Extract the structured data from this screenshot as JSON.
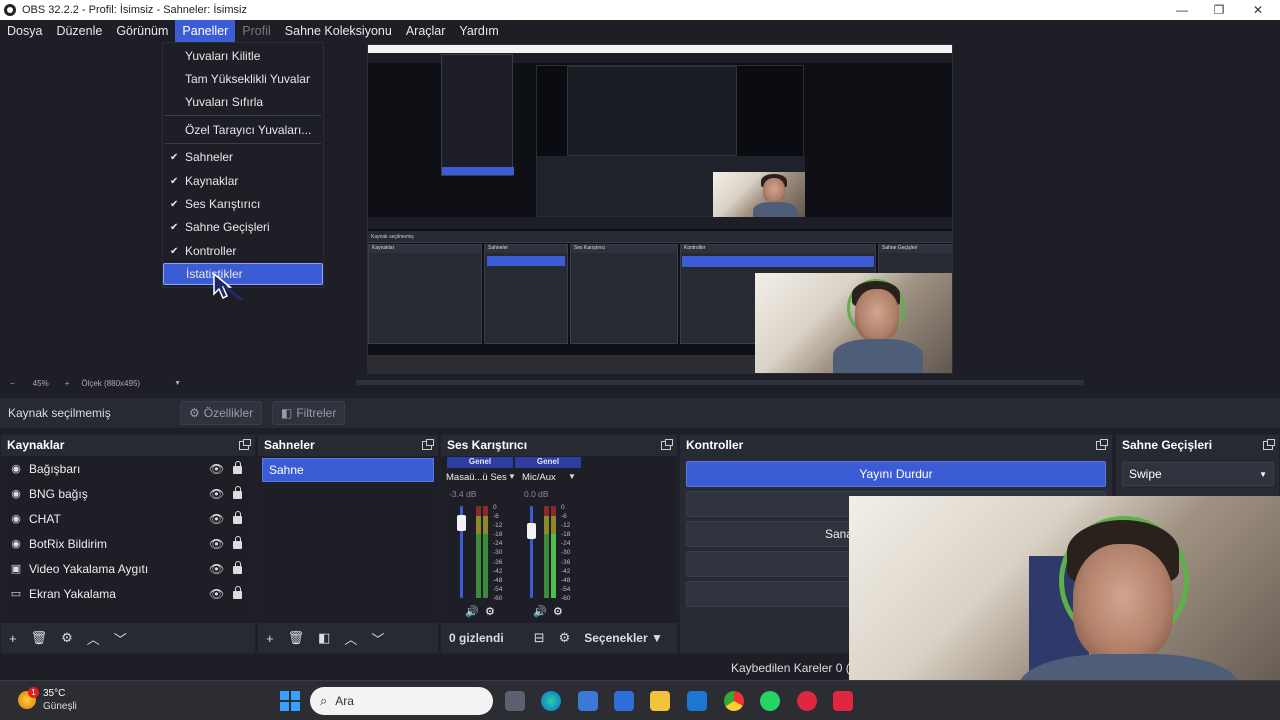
{
  "window": {
    "title": "OBS 32.2.2 - Profil: İsimsiz - Sahneler: İsimsiz",
    "minimize": "—",
    "maximize": "❐",
    "close": "✕"
  },
  "menu": [
    {
      "label": "Dosya"
    },
    {
      "label": "Düzenle"
    },
    {
      "label": "Görünüm"
    },
    {
      "label": "Paneller"
    },
    {
      "label": "Profil"
    },
    {
      "label": "Sahne Koleksiyonu"
    },
    {
      "label": "Araçlar"
    },
    {
      "label": "Yardım"
    }
  ],
  "dropdown": {
    "items": [
      {
        "label": "Yuvaları Kilitle",
        "checked": false
      },
      {
        "label": "Tam Yükseklikli Yuvalar",
        "checked": false
      },
      {
        "label": "Yuvaları Sıfırla",
        "checked": false
      },
      {
        "label": "Özel Tarayıcı Yuvaları...",
        "checked": false
      },
      {
        "label": "Sahneler",
        "checked": true
      },
      {
        "label": "Kaynaklar",
        "checked": true
      },
      {
        "label": "Ses Karıştırıcı",
        "checked": true
      },
      {
        "label": "Sahne Geçişleri",
        "checked": true
      },
      {
        "label": "Kontroller",
        "checked": true
      },
      {
        "label": "İstatistikler",
        "checked": false
      }
    ],
    "check_glyph": "✔"
  },
  "preview_status": {
    "zoom": "45%",
    "scale": "Ölçek (880x495)",
    "minus": "−",
    "plus": "+"
  },
  "source_toolbar": {
    "no_source": "Kaynak seçilmemiş",
    "properties": "Özellikler",
    "filters": "Filtreler"
  },
  "sources": {
    "title": "Kaynaklar",
    "items": [
      {
        "label": "Bağışbarı",
        "icon": "browser-icon"
      },
      {
        "label": "BNG bağış",
        "icon": "browser-icon"
      },
      {
        "label": "CHAT",
        "icon": "browser-icon"
      },
      {
        "label": "BotRix Bildirim",
        "icon": "browser-icon"
      },
      {
        "label": "Video Yakalama Aygıtı",
        "icon": "camera-icon"
      },
      {
        "label": "Ekran Yakalama",
        "icon": "monitor-icon"
      }
    ]
  },
  "scenes": {
    "title": "Sahneler",
    "items": [
      {
        "label": "Sahne"
      }
    ]
  },
  "mixer": {
    "title": "Ses Karıştırıcı",
    "channels": [
      {
        "group": "Genel",
        "name": "Masaü...ü Ses",
        "db": "-3.4 dB",
        "level": 0.55
      },
      {
        "group": "Genel",
        "name": "Mic/Aux",
        "db": "0.0 dB",
        "level": 0.2
      }
    ],
    "ticks": [
      "0",
      "-6",
      "-12",
      "-18",
      "-24",
      "-30",
      "-36",
      "-42",
      "-48",
      "-54",
      "-60"
    ],
    "hidden": "0 gizlendi",
    "options": "Seçenekler"
  },
  "controls": {
    "title": "Kontroller",
    "stop_stream": "Yayını Durdur",
    "partial_label": "Sana"
  },
  "transitions": {
    "title": "Sahne Geçişleri",
    "selected": "Swipe"
  },
  "status": {
    "dropped": "Kaybedilen Kareler 0 (%"
  },
  "taskbar": {
    "weather_temp": "35°C",
    "weather_text": "Güneşli",
    "badge": "1",
    "search": "Ara"
  }
}
